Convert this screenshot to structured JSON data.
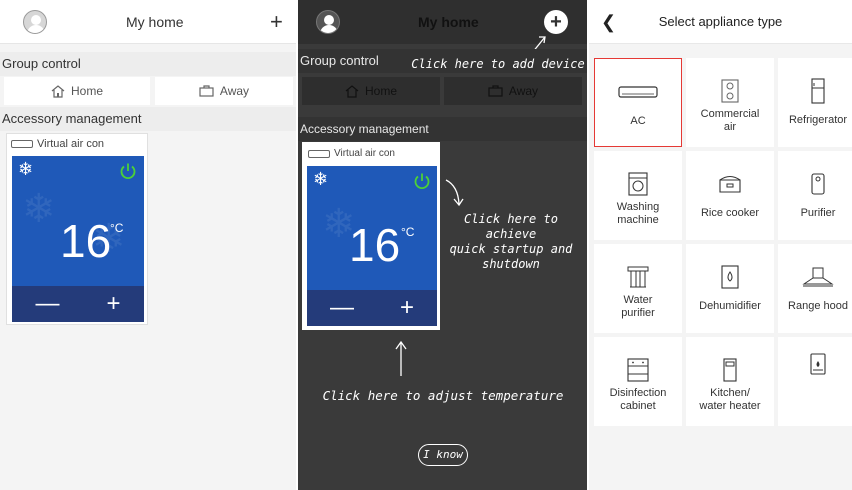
{
  "colors": {
    "ac_blue": "#1f59b8",
    "ac_dark_blue": "#243b7a",
    "power_green": "#4cd137",
    "selected_border": "#e53935",
    "overlay_bg": "#3a3a3a"
  },
  "home": {
    "title": "My home",
    "add_icon": "plus-icon",
    "group_control_label": "Group control",
    "home_mode_label": "Home",
    "away_mode_label": "Away",
    "accessory_label": "Accessory management",
    "device_name": "Virtual air con",
    "temperature": "16",
    "unit": "°C",
    "minus_label": "—",
    "plus_label": "+"
  },
  "guide": {
    "title": "My home",
    "group_control_label": "Group control",
    "home_mode_label": "Home",
    "away_mode_label": "Away",
    "accessory_label": "Accessory management",
    "device_name": "Virtual air con",
    "temperature": "16",
    "unit": "°C",
    "minus_label": "—",
    "plus_label": "+",
    "hint_add": "Click here to add device",
    "hint_power_1": "Click here to achieve",
    "hint_power_2": "quick startup and",
    "hint_power_3": "shutdown",
    "hint_temp": "Click here to adjust temperature",
    "know_button": "I know"
  },
  "select": {
    "back_icon": "chevron-left-icon",
    "title": "Select appliance type",
    "appliances": [
      {
        "label_1": "AC",
        "label_2": "",
        "icon": "ac-icon",
        "selected": true
      },
      {
        "label_1": "Commercial",
        "label_2": "air",
        "icon": "commercial-air-icon",
        "selected": false
      },
      {
        "label_1": "Refrigerator",
        "label_2": "",
        "icon": "refrigerator-icon",
        "selected": false
      },
      {
        "label_1": "Washing",
        "label_2": "machine",
        "icon": "washing-machine-icon",
        "selected": false
      },
      {
        "label_1": "Rice cooker",
        "label_2": "",
        "icon": "rice-cooker-icon",
        "selected": false
      },
      {
        "label_1": "Purifier",
        "label_2": "",
        "icon": "purifier-icon",
        "selected": false
      },
      {
        "label_1": "Water",
        "label_2": "purifier",
        "icon": "water-purifier-icon",
        "selected": false
      },
      {
        "label_1": "Dehumidifier",
        "label_2": "",
        "icon": "dehumidifier-icon",
        "selected": false
      },
      {
        "label_1": "Range hood",
        "label_2": "",
        "icon": "range-hood-icon",
        "selected": false
      },
      {
        "label_1": "Disinfection",
        "label_2": "cabinet",
        "icon": "disinfection-cabinet-icon",
        "selected": false
      },
      {
        "label_1": "Kitchen/",
        "label_2": "water heater",
        "icon": "water-heater-icon",
        "selected": false
      },
      {
        "label_1": "",
        "label_2": "",
        "icon": "boiler-icon",
        "selected": false
      }
    ]
  }
}
